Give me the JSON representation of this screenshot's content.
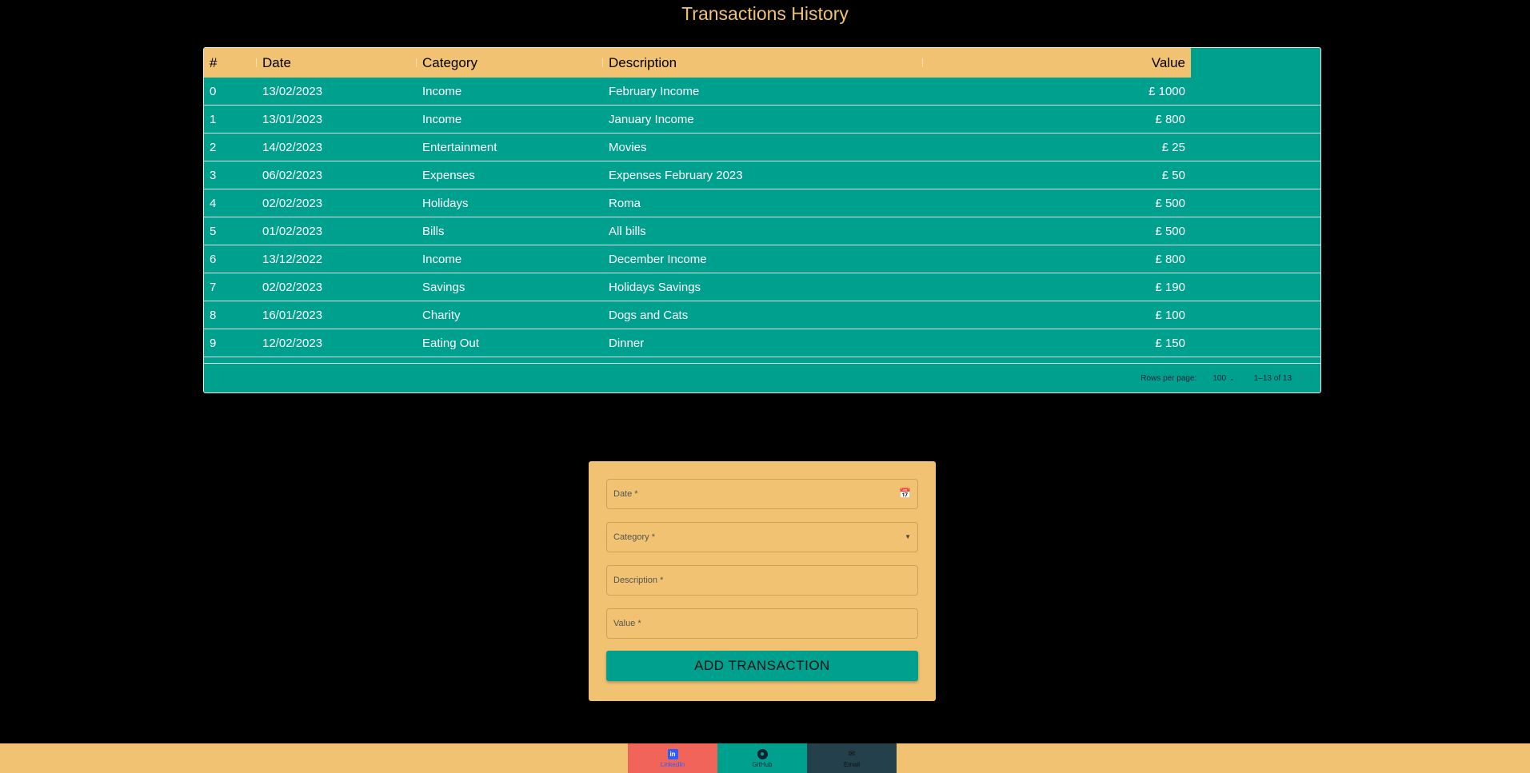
{
  "page": {
    "title": "Transactions History"
  },
  "grid": {
    "headers": {
      "idx": "#",
      "date": "Date",
      "category": "Category",
      "description": "Description",
      "value": "Value"
    },
    "rows": [
      {
        "idx": "0",
        "date": "13/02/2023",
        "category": "Income",
        "description": "February Income",
        "value": "£ 1000"
      },
      {
        "idx": "1",
        "date": "13/01/2023",
        "category": "Income",
        "description": "January Income",
        "value": "£ 800"
      },
      {
        "idx": "2",
        "date": "14/02/2023",
        "category": "Entertainment",
        "description": "Movies",
        "value": "£ 25"
      },
      {
        "idx": "3",
        "date": "06/02/2023",
        "category": "Expenses",
        "description": "Expenses February 2023",
        "value": "£ 50"
      },
      {
        "idx": "4",
        "date": "02/02/2023",
        "category": "Holidays",
        "description": "Roma",
        "value": "£ 500"
      },
      {
        "idx": "5",
        "date": "01/02/2023",
        "category": "Bills",
        "description": "All bills",
        "value": "£ 500"
      },
      {
        "idx": "6",
        "date": "13/12/2022",
        "category": "Income",
        "description": "December Income",
        "value": "£ 800"
      },
      {
        "idx": "7",
        "date": "02/02/2023",
        "category": "Savings",
        "description": "Holidays Savings",
        "value": "£ 190"
      },
      {
        "idx": "8",
        "date": "16/01/2023",
        "category": "Charity",
        "description": "Dogs and Cats",
        "value": "£ 100"
      },
      {
        "idx": "9",
        "date": "12/02/2023",
        "category": "Eating Out",
        "description": "Dinner",
        "value": "£ 150"
      }
    ],
    "footer": {
      "rows_per_page_label": "Rows per page:",
      "rows_per_page_value": "100",
      "range": "1–13 of 13"
    }
  },
  "form": {
    "date_label": "Date *",
    "category_label": "Category *",
    "description_label": "Description *",
    "value_label": "Value *",
    "submit_label": "ADD TRANSACTION"
  },
  "footer": {
    "linkedin_label": "LinkedIn",
    "github_label": "GitHub",
    "email_label": "Email"
  },
  "colors": {
    "accent": "#f0c272",
    "teal": "#00a08f",
    "background": "#000000"
  }
}
